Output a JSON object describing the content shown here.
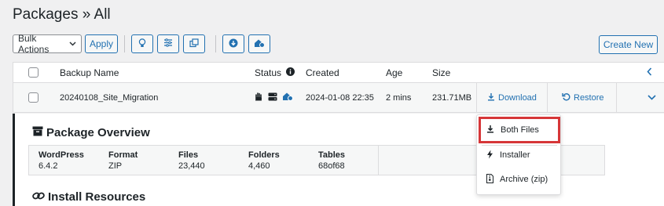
{
  "page": {
    "title": "Packages » All"
  },
  "toolbar": {
    "bulk_actions": "Bulk Actions",
    "apply_label": "Apply",
    "create_new_label": "Create New"
  },
  "table": {
    "headers": {
      "name": "Backup Name",
      "status": "Status",
      "created": "Created",
      "age": "Age",
      "size": "Size"
    },
    "row": {
      "name": "20240108_Site_Migration",
      "created": "2024-01-08 22:35",
      "age": "2 mins",
      "size": "231.71MB",
      "download_label": "Download",
      "restore_label": "Restore"
    }
  },
  "details": {
    "overview_title": "Package Overview",
    "resources_title": "Install Resources",
    "columns": [
      {
        "label": "WordPress",
        "value": "6.4.2"
      },
      {
        "label": "Format",
        "value": "ZIP"
      },
      {
        "label": "Files",
        "value": "23,440"
      },
      {
        "label": "Folders",
        "value": "4,460"
      },
      {
        "label": "Tables",
        "value": "68of68"
      }
    ]
  },
  "dropdown": {
    "items": [
      {
        "label": "Both Files",
        "icon": "download-icon"
      },
      {
        "label": "Installer",
        "icon": "bolt-icon"
      },
      {
        "label": "Archive (zip)",
        "icon": "file-archive-icon"
      }
    ]
  },
  "colors": {
    "accent": "#2271b1",
    "highlight": "#d63638",
    "text": "#1d2327"
  }
}
